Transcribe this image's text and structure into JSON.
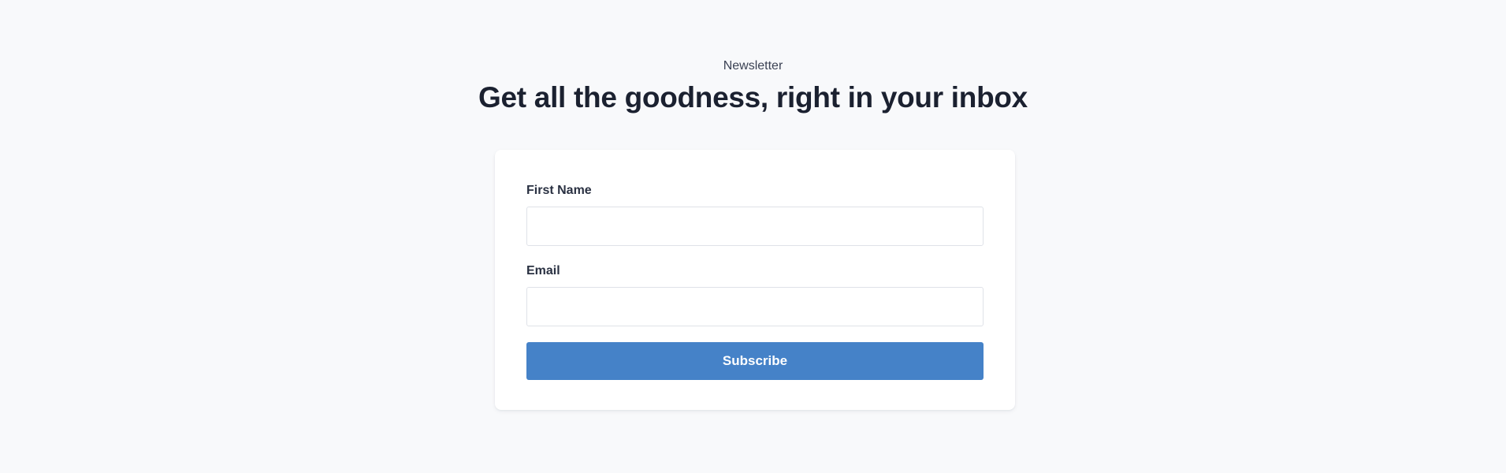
{
  "header": {
    "eyebrow": "Newsletter",
    "title": "Get all the goodness, right in your inbox"
  },
  "form": {
    "first_name": {
      "label": "First Name",
      "value": "",
      "placeholder": ""
    },
    "email": {
      "label": "Email",
      "value": "",
      "placeholder": ""
    },
    "submit_label": "Subscribe"
  },
  "colors": {
    "background": "#f8f9fb",
    "card": "#ffffff",
    "button": "#4582c8",
    "heading": "#1b2130"
  }
}
